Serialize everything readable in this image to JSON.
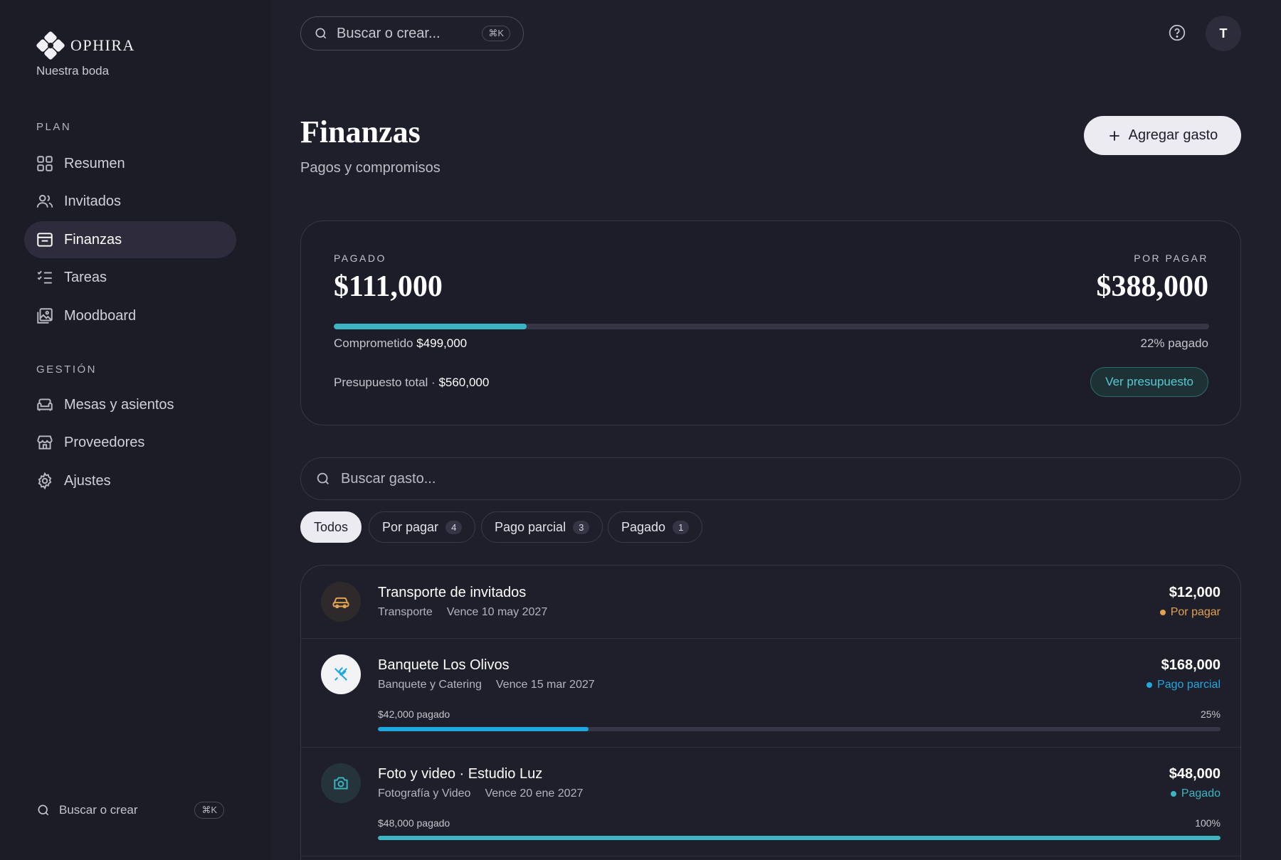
{
  "brand": {
    "name": "OPHIRA",
    "subtitle": "Nuestra boda"
  },
  "sidebar": {
    "plan_label": "PLAN",
    "plan_items": [
      {
        "label": "Resumen",
        "icon": "grid-icon"
      },
      {
        "label": "Invitados",
        "icon": "users-icon"
      },
      {
        "label": "Finanzas",
        "icon": "wallet-icon",
        "active": true
      },
      {
        "label": "Tareas",
        "icon": "checklist-icon"
      },
      {
        "label": "Moodboard",
        "icon": "image-gallery-icon"
      }
    ],
    "gestion_label": "GESTIÓN",
    "gestion_items": [
      {
        "label": "Mesas y asientos",
        "icon": "sofa-icon"
      },
      {
        "label": "Proveedores",
        "icon": "store-icon"
      },
      {
        "label": "Ajustes",
        "icon": "gear-icon"
      }
    ],
    "search_label": "Buscar o crear",
    "search_kbd": "⌘K"
  },
  "topbar": {
    "search_placeholder": "Buscar o crear...",
    "search_kbd": "⌘K",
    "avatar_initial": "T"
  },
  "header": {
    "title": "Finanzas",
    "subtitle": "Pagos y compromisos",
    "add_button": "Agregar gasto"
  },
  "summary": {
    "paid_label": "PAGADO",
    "paid_value": "$111,000",
    "pending_label": "POR PAGAR",
    "pending_value": "$388,000",
    "progress_fraction": 0.22,
    "committed_label": "Comprometido",
    "committed_value": "$499,000",
    "paid_percent_text": "22% pagado",
    "budget_label": "Presupuesto total ·",
    "budget_value": "$560,000",
    "budget_button": "Ver presupuesto"
  },
  "expense_search": {
    "placeholder": "Buscar gasto..."
  },
  "filters": [
    {
      "label": "Todos",
      "count": "",
      "active": true
    },
    {
      "label": "Por pagar",
      "count": "4"
    },
    {
      "label": "Pago parcial",
      "count": "3"
    },
    {
      "label": "Pagado",
      "count": "1"
    }
  ],
  "colors": {
    "accent": "#3bb5c2",
    "pending": "#e0a24f",
    "partial": "#1fa8e0",
    "paid": "#3bb5c2"
  },
  "expenses": [
    {
      "title": "Transporte de invitados",
      "category": "Transporte",
      "due": "Vence 10 may 2027",
      "amount": "$12,000",
      "status": "Por pagar",
      "icon": "car-icon"
    },
    {
      "title": "Banquete Los Olivos",
      "category": "Banquete y Catering",
      "due": "Vence 15 mar 2027",
      "amount": "$168,000",
      "status": "Pago parcial",
      "icon": "utensils-icon",
      "paid_text": "$42,000 pagado",
      "percent_text": "25%",
      "progress_fraction": 0.25
    },
    {
      "title": "Foto y video · Estudio Luz",
      "category": "Fotografía y Video",
      "due": "Vence 20 ene 2027",
      "amount": "$48,000",
      "status": "Pagado",
      "icon": "camera-icon",
      "paid_text": "$48,000 pagado",
      "percent_text": "100%",
      "progress_fraction": 1.0
    }
  ]
}
